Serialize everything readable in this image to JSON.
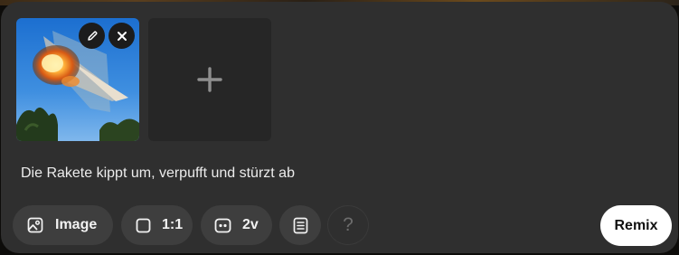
{
  "composer": {
    "prompt_text": "Die Rakete kippt um, verpufft und stürzt ab",
    "images": [
      {
        "icon": "rocket-explosion-thumbnail",
        "actions": [
          "pencil-icon",
          "close-icon"
        ]
      }
    ],
    "add_image_icon": "plus-icon"
  },
  "toolbar": {
    "image_label": "Image",
    "aspect_ratio_label": "1:1",
    "variations_label": "2v",
    "help_label": "?",
    "remix_label": "Remix"
  },
  "colors": {
    "panel_bg": "#2f2f2f",
    "pill_bg": "#3e3e3e",
    "remix_bg": "#ffffff"
  }
}
